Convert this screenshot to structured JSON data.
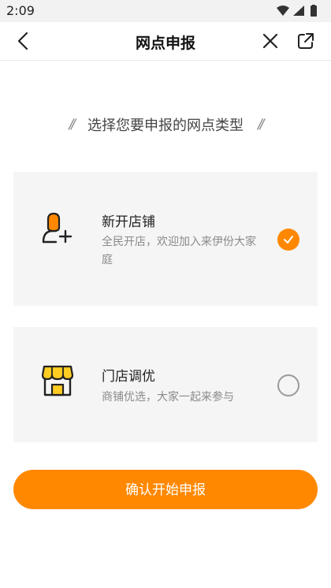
{
  "status_bar": {
    "time": "2:09",
    "icons": [
      "wifi-icon",
      "signal-icon",
      "battery-icon"
    ]
  },
  "header": {
    "title": "网点申报",
    "back_icon": "back-arrow-icon",
    "close_icon": "close-icon",
    "share_icon": "external-link-icon"
  },
  "section": {
    "heading": "选择您要申报的网点类型",
    "decoration": "//"
  },
  "options": [
    {
      "title": "新开店铺",
      "description": "全民开店，欢迎加入来伊份大家庭",
      "icon": "add-user-icon",
      "selected": true
    },
    {
      "title": "门店调优",
      "description": "商铺优选，大家一起来参与",
      "icon": "storefront-icon",
      "selected": false
    }
  ],
  "confirm_button": {
    "label": "确认开始申报"
  },
  "colors": {
    "accent": "#ff8800",
    "card_background": "#f5f5f5",
    "status_bar": "#f2f2f2"
  }
}
